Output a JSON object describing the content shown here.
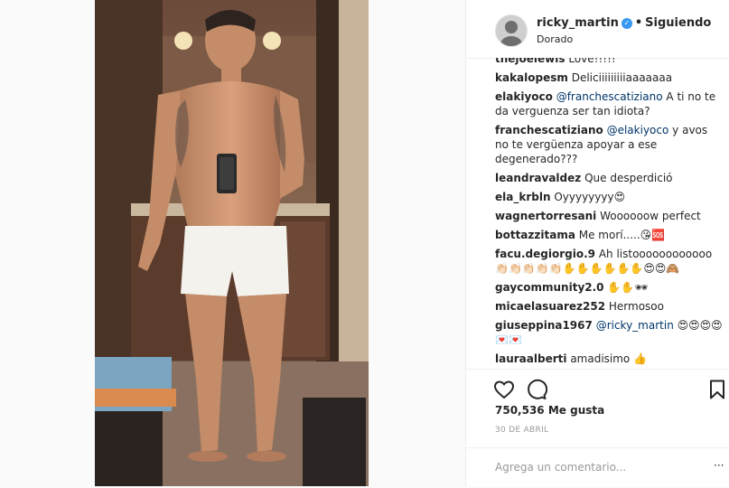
{
  "header": {
    "username": "ricky_martin",
    "verified_icon": "verified-badge-icon",
    "separator": "•",
    "follow_label": "Siguiendo",
    "location": "Dorado"
  },
  "comments": [
    {
      "user": "thejoelewis",
      "text": "Love!!!!!"
    },
    {
      "user": "kakalopesm",
      "text": "Deliciiiiiiiiiaaaaaaa"
    },
    {
      "user": "elakiyoco",
      "mention": "@franchescatiziano",
      "text": "A ti no te da verguenza ser tan idiota?"
    },
    {
      "user": "franchescatiziano",
      "mention": "@elakiyoco",
      "text": "y avos no te vergüenza apoyar a ese degenerado???"
    },
    {
      "user": "leandravaldez",
      "text": "Que desperdició"
    },
    {
      "user": "ela_krbln",
      "text": "Oyyyyyyyy😍"
    },
    {
      "user": "wagnertorresani",
      "text": "Woooooow perfect"
    },
    {
      "user": "bottazzitama",
      "text": "Me morí.....😘🆘"
    },
    {
      "user": "facu.degiorgio.9",
      "text": "Ah listoooooooooooo👏🏻👏🏻👏🏻👏🏻👏🏻✋✋✋✋✋✋😍😍🙈"
    },
    {
      "user": "gaycommunity2.0",
      "text": "✋✋🕶"
    },
    {
      "user": "micaelasuarez252",
      "text": "Hermosoo"
    },
    {
      "user": "giuseppina1967",
      "mention": "@ricky_martin",
      "text": "😍😍😍😍💌💌"
    },
    {
      "user": "lauraalberti",
      "text": "amadisimo 👍"
    }
  ],
  "actions": {
    "like_icon": "heart-icon",
    "comment_icon": "comment-bubble-icon",
    "save_icon": "bookmark-icon",
    "likes_count": "750,536",
    "likes_label": "Me gusta",
    "date": "30 DE ABRIL"
  },
  "add_comment": {
    "placeholder": "Agrega un comentario...",
    "more_label": "···"
  }
}
